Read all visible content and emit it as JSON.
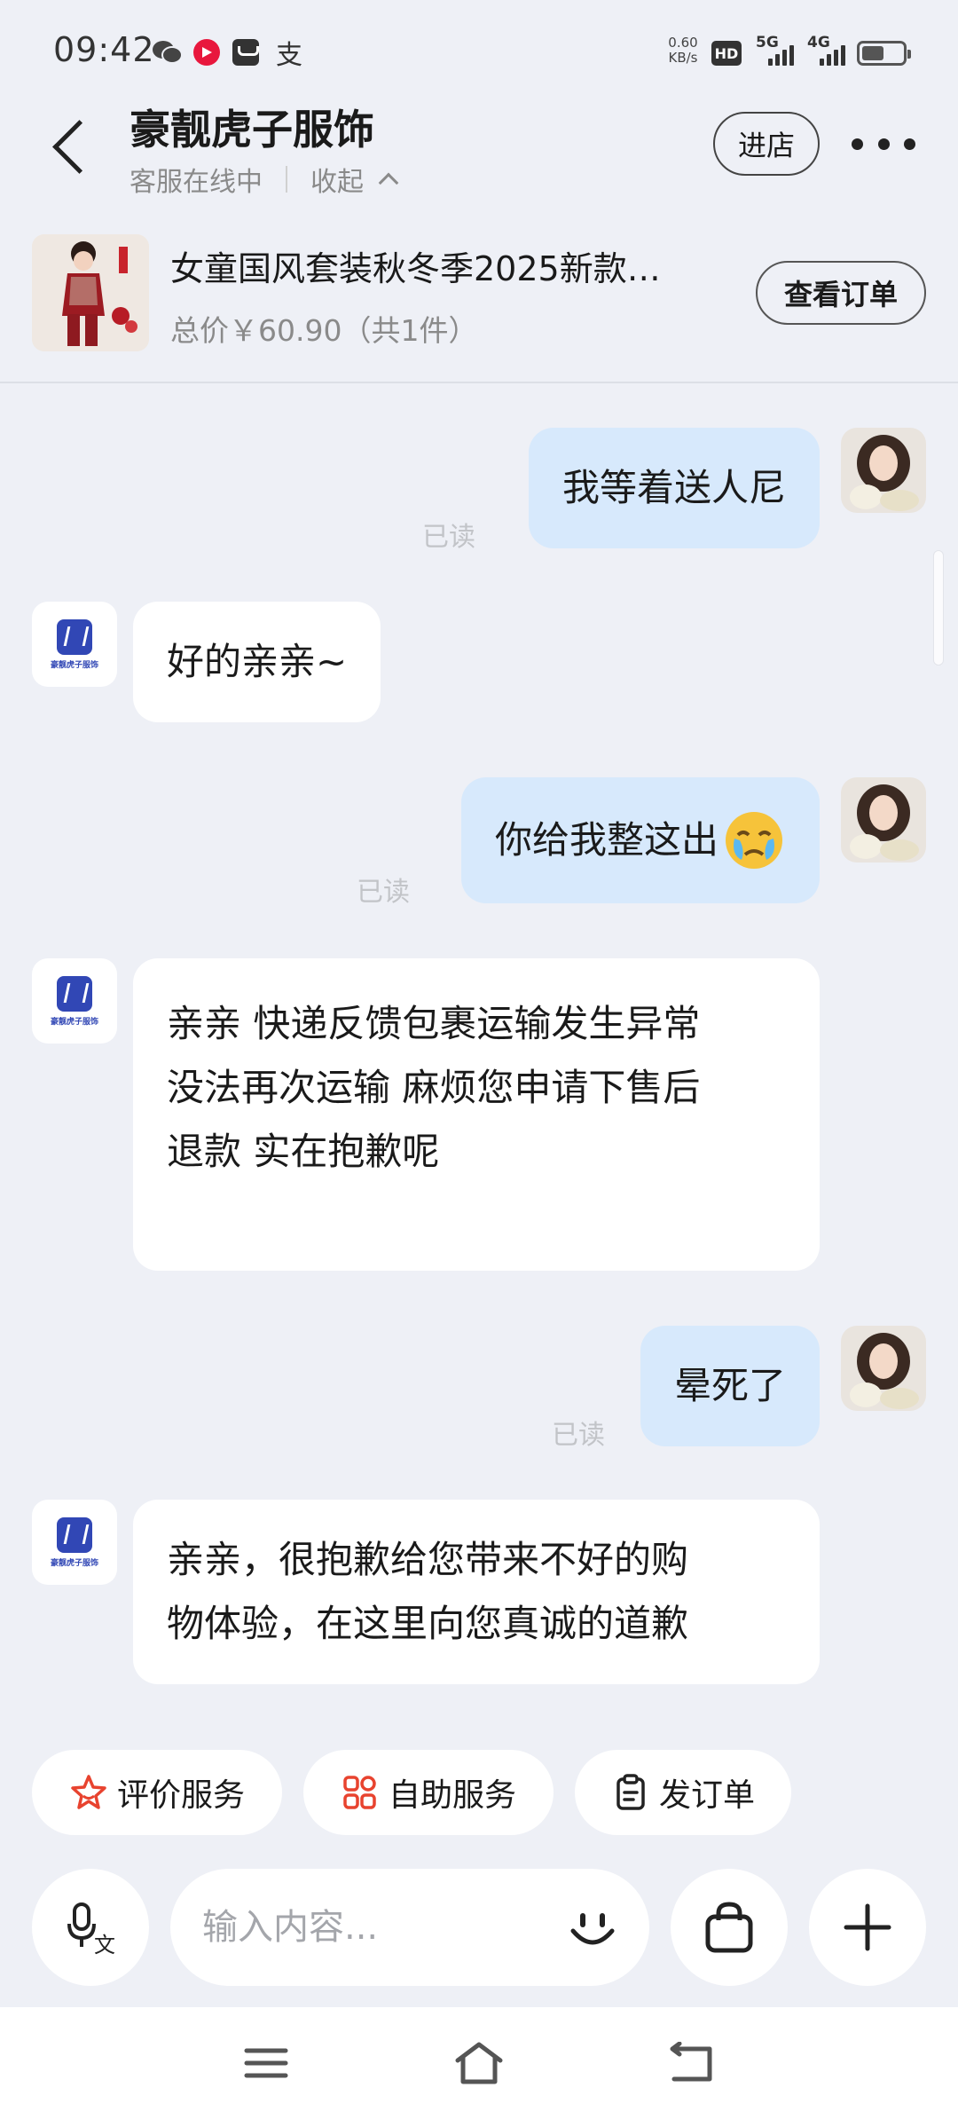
{
  "status_bar": {
    "time": "09:42",
    "speed_value": "0.60",
    "speed_unit": "KB/s",
    "hd_label": "HD",
    "signal1": "5G",
    "signal2": "4G",
    "alipay_glyph": "支",
    "battery_level": 0.55
  },
  "header": {
    "shop_name": "豪靓虎子服饰",
    "status": "客服在线中",
    "collapse_label": "收起",
    "enter_shop_label": "进店"
  },
  "product": {
    "title": "女童国风套装秋冬季2025新款…",
    "price": "总价￥60.90（共1件）",
    "view_order_label": "查看订单"
  },
  "shop_avatar_text": "豪靓虎子服饰",
  "messages": [
    {
      "from": "user",
      "text": "我等着送人尼",
      "read": "已读"
    },
    {
      "from": "shop",
      "text": "好的亲亲~"
    },
    {
      "from": "user",
      "text": "你给我整这出",
      "emoji": "😢",
      "read": "已读"
    },
    {
      "from": "shop",
      "lines": [
        "亲亲 快递反馈包裹运输发生异常",
        "没法再次运输 麻烦您申请下售后",
        "退款 实在抱歉呢"
      ]
    },
    {
      "from": "user",
      "text": "晕死了",
      "read": "已读"
    },
    {
      "from": "shop",
      "lines": [
        "亲亲，很抱歉给您带来不好的购",
        "物体验，在这里向您真诚的道歉"
      ]
    }
  ],
  "quick_actions": {
    "rate": "评价服务",
    "self_service": "自助服务",
    "send_order": "发订单"
  },
  "input": {
    "placeholder": "输入内容..."
  },
  "colors": {
    "background": "#eef0f6",
    "user_bubble": "#d7e9fc",
    "shop_bubble": "#ffffff",
    "accent_red": "#e8432f",
    "shop_logo_blue": "#3147b5"
  }
}
